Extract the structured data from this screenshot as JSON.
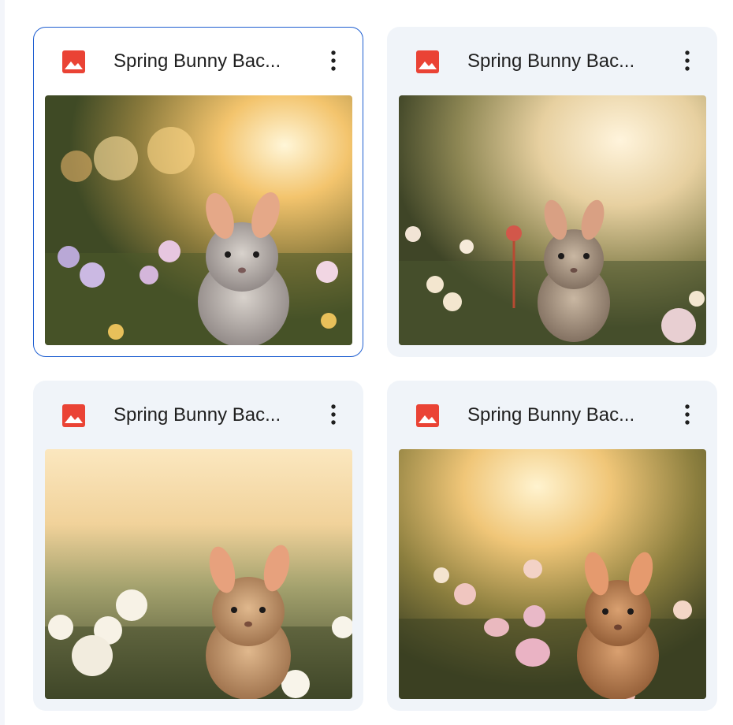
{
  "files": [
    {
      "name": "Spring Bunny Bac...",
      "type": "image",
      "selected": true
    },
    {
      "name": "Spring Bunny Bac...",
      "type": "image",
      "selected": false
    },
    {
      "name": "Spring Bunny Bac...",
      "type": "image",
      "selected": false
    },
    {
      "name": "Spring Bunny Bac...",
      "type": "image",
      "selected": false
    }
  ],
  "icons": {
    "file_type": "image-file-icon",
    "more": "more-vert-icon"
  },
  "colors": {
    "image_icon": "#ea4335",
    "card_bg": "#f0f4f9",
    "selected_border": "#1f5fd1",
    "title_text": "#1f1f1f"
  }
}
